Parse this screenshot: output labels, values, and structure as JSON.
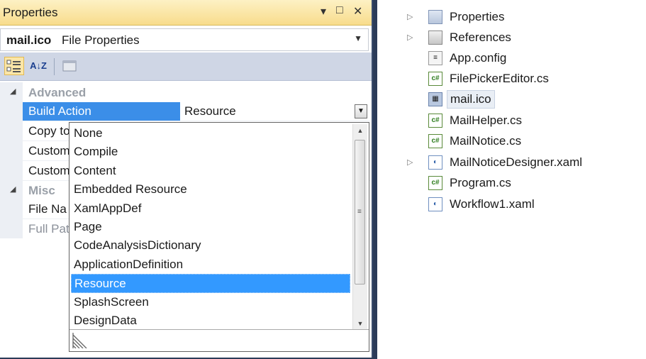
{
  "properties": {
    "title": "Properties",
    "title_buttons": [
      "▾",
      "□",
      "✕"
    ],
    "object_name": "mail.ico",
    "object_type": "File Properties",
    "toolbar": {
      "categorized_icon": "categorized-icon",
      "alphabetical_icon": "alphabetical-sort-icon",
      "alphabetical_label": "A↓Z",
      "property_pages_icon": "property-pages-icon"
    },
    "categories": [
      {
        "label": "Advanced"
      },
      {
        "label": "Misc"
      }
    ],
    "rows": [
      {
        "name": "Build Action",
        "value": "Resource"
      },
      {
        "name": "Copy to",
        "value": ""
      },
      {
        "name": "Custom",
        "value": ""
      },
      {
        "name": "Custom",
        "value": ""
      },
      {
        "name": "File Na",
        "value": ""
      },
      {
        "name": "Full Pat",
        "value": ""
      }
    ]
  },
  "dropdown": {
    "items": [
      "None",
      "Compile",
      "Content",
      "Embedded Resource",
      "XamlAppDef",
      "Page",
      "CodeAnalysisDictionary",
      "ApplicationDefinition",
      "Resource",
      "SplashScreen",
      "DesignData"
    ],
    "selected": "Resource"
  },
  "solution": {
    "items": [
      {
        "label": "Properties",
        "icon": "folder-icon",
        "expandable": true
      },
      {
        "label": "References",
        "icon": "references-icon",
        "expandable": true
      },
      {
        "label": "App.config",
        "icon": "config-file-icon",
        "expandable": false
      },
      {
        "label": "FilePickerEditor.cs",
        "icon": "csharp-file-icon",
        "expandable": false
      },
      {
        "label": "mail.ico",
        "icon": "icon-file-icon",
        "expandable": false,
        "selected": true
      },
      {
        "label": "MailHelper.cs",
        "icon": "csharp-file-icon",
        "expandable": false
      },
      {
        "label": "MailNotice.cs",
        "icon": "csharp-file-icon",
        "expandable": false
      },
      {
        "label": "MailNoticeDesigner.xaml",
        "icon": "xaml-file-icon",
        "expandable": true
      },
      {
        "label": "Program.cs",
        "icon": "csharp-file-icon",
        "expandable": false
      },
      {
        "label": "Workflow1.xaml",
        "icon": "xaml-file-icon",
        "expandable": false
      }
    ]
  }
}
